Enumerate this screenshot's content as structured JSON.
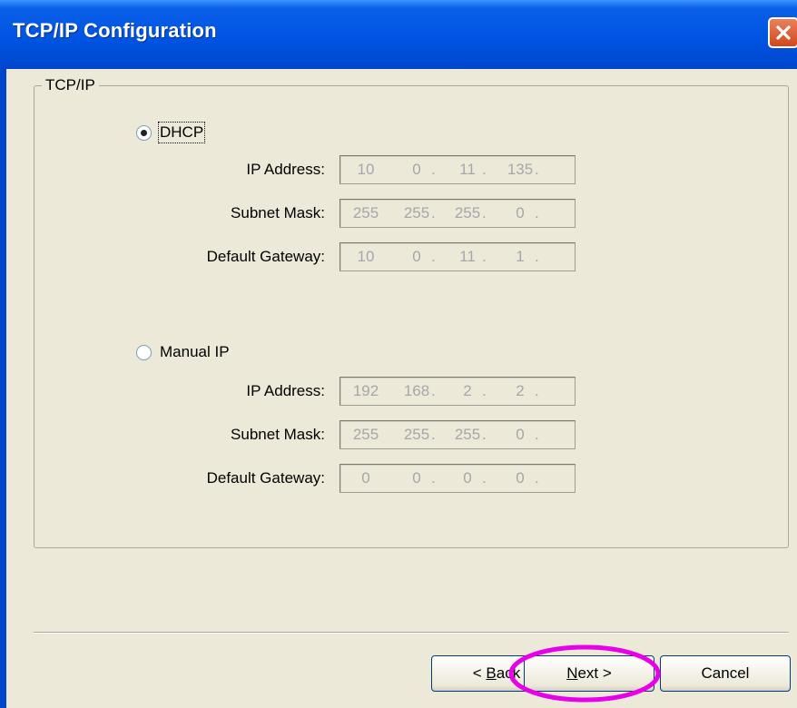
{
  "window": {
    "title": "TCP/IP Configuration",
    "close_icon": "close-icon"
  },
  "group": {
    "legend": "TCP/IP"
  },
  "dhcp": {
    "label": "DHCP",
    "selected": true,
    "fields": [
      {
        "label": "IP Address:",
        "octets": [
          "10",
          "0",
          "11",
          "135"
        ]
      },
      {
        "label": "Subnet Mask:",
        "octets": [
          "255",
          "255",
          "255",
          "0"
        ]
      },
      {
        "label": "Default Gateway:",
        "octets": [
          "10",
          "0",
          "11",
          "1"
        ]
      }
    ]
  },
  "manual": {
    "label": "Manual IP",
    "selected": false,
    "fields": [
      {
        "label": "IP Address:",
        "octets": [
          "192",
          "168",
          "2",
          "2"
        ]
      },
      {
        "label": "Subnet Mask:",
        "octets": [
          "255",
          "255",
          "255",
          "0"
        ]
      },
      {
        "label": "Default Gateway:",
        "octets": [
          "0",
          "0",
          "0",
          "0"
        ]
      }
    ]
  },
  "buttons": {
    "back": {
      "prefix": "< ",
      "mnemonic": "B",
      "rest": "ack"
    },
    "next": {
      "mnemonic": "N",
      "rest": "ext >"
    },
    "cancel": {
      "label": "Cancel"
    }
  },
  "colors": {
    "title_bar": "#0054e3",
    "highlight_ring": "#e800e8",
    "close_button": "#d2471c"
  }
}
